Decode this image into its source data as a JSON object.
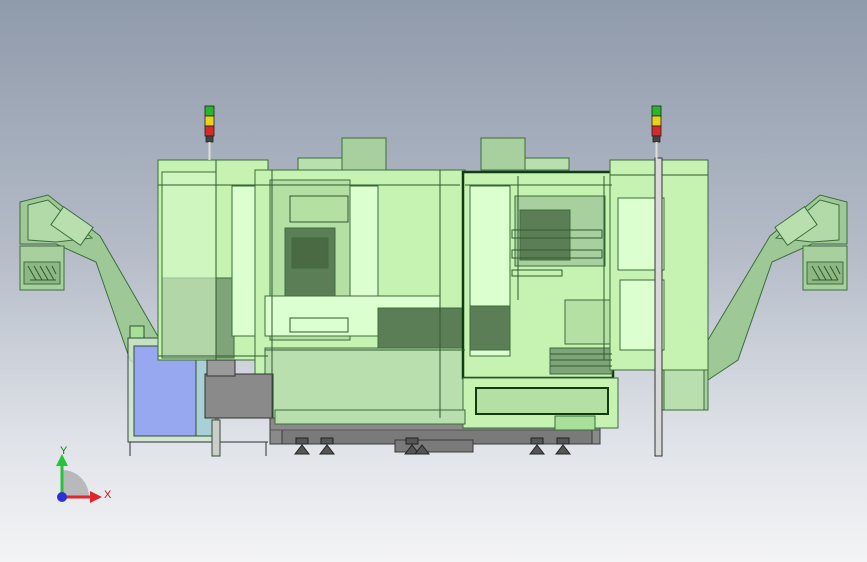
{
  "view": {
    "axis_triad": {
      "x_label": "X",
      "y_label": "Y",
      "x_color": "#e0262a",
      "y_color": "#29c23d",
      "z_color": "#2a2fd6"
    },
    "colors": {
      "model_fill": "#c6f2b2",
      "model_fill_light": "#dcffd0",
      "model_edge": "#3b6e3b",
      "model_edge_dark": "#0f3d0f",
      "shade_mid": "#7fa47a",
      "shade_dark": "#5c7e56",
      "chute_fill": "#9ec996",
      "base_gray": "#8a8a8a",
      "feet": "#555555",
      "blue_panel": "#97a7f0",
      "lamp_green": "#2bb52b",
      "lamp_yellow": "#e8d21e",
      "lamp_red": "#d42a2a"
    },
    "icons": {
      "left_signal_tower": "signal-tower-icon",
      "right_signal_tower": "signal-tower-icon",
      "triad": "coordinate-triad-icon"
    }
  }
}
